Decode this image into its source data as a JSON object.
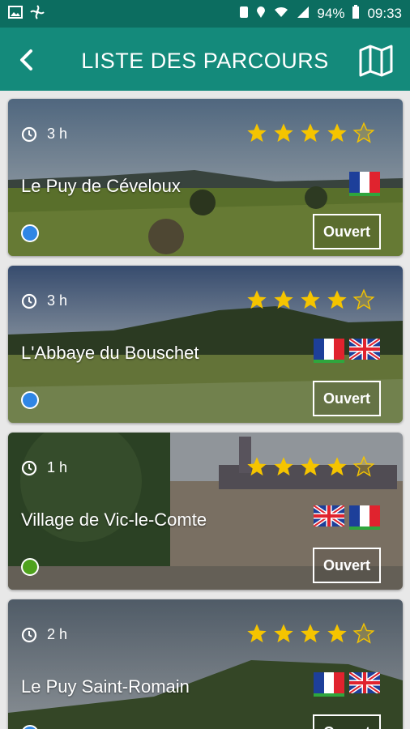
{
  "status": {
    "battery": "94%",
    "time": "09:33"
  },
  "appbar": {
    "title": "LISTE DES PARCOURS"
  },
  "cards": [
    {
      "duration": "3 h",
      "title": "Le Puy de Céveloux",
      "rating": 4,
      "button": "Ouvert",
      "flags": [
        "fr"
      ],
      "selected_flag": "fr",
      "dot_color": "#2f86e5"
    },
    {
      "duration": "3 h",
      "title": "L'Abbaye du Bouschet",
      "rating": 4,
      "button": "Ouvert",
      "flags": [
        "fr",
        "uk"
      ],
      "selected_flag": "fr",
      "dot_color": "#2f86e5"
    },
    {
      "duration": "1 h",
      "title": "Village de Vic-le-Comte",
      "rating": 4,
      "button": "Ouvert",
      "flags": [
        "uk",
        "fr"
      ],
      "selected_flag": "fr",
      "dot_color": "#4fa21d"
    },
    {
      "duration": "2 h",
      "title": "Le Puy Saint-Romain",
      "rating": 4,
      "button": "Ouvert",
      "flags": [
        "fr",
        "uk"
      ],
      "selected_flag": "fr",
      "dot_color": "#2f86e5"
    }
  ],
  "colors": {
    "statusbar": "#0c6d60",
    "appbar": "#148a7b",
    "star": "#f5c400",
    "selected_flag_line": "#2fa63d"
  }
}
